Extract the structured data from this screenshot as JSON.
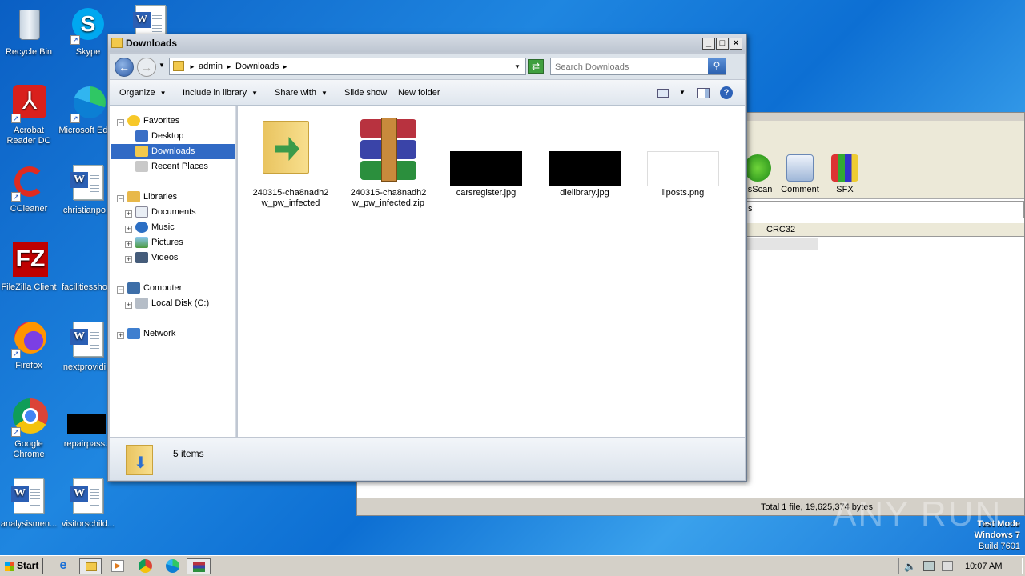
{
  "desktop": {
    "icons": [
      {
        "label": "Recycle Bin"
      },
      {
        "label": "Skype"
      },
      {
        "label": "Acrobat Reader DC"
      },
      {
        "label": "Microsoft Edge"
      },
      {
        "label": "CCleaner"
      },
      {
        "label": "christianpo..."
      },
      {
        "label": "FileZilla Client"
      },
      {
        "label": "facilitiessho..."
      },
      {
        "label": "Firefox"
      },
      {
        "label": "nextprovidi..."
      },
      {
        "label": "Google Chrome"
      },
      {
        "label": "repairpass..."
      },
      {
        "label": "analysismen..."
      },
      {
        "label": "visitorschild..."
      }
    ],
    "watermark": "ANY RUN",
    "os_info": {
      "line1": "Test Mode",
      "line2": "Windows 7",
      "line3": "Build 7601"
    }
  },
  "winrar": {
    "tools": [
      "usScan",
      "Comment",
      "SFX"
    ],
    "column_crc": "CRC32",
    "address_fragment": "s",
    "status": "Total 1 file, 19,625,374 bytes"
  },
  "explorer": {
    "title": "Downloads",
    "breadcrumb": [
      "admin",
      "Downloads"
    ],
    "search_placeholder": "Search Downloads",
    "commands": {
      "organize": "Organize",
      "include": "Include in library",
      "share": "Share with",
      "slideshow": "Slide show",
      "newfolder": "New folder"
    },
    "nav": {
      "favorites": "Favorites",
      "desktop": "Desktop",
      "downloads": "Downloads",
      "recent": "Recent Places",
      "libraries": "Libraries",
      "documents": "Documents",
      "music": "Music",
      "pictures": "Pictures",
      "videos": "Videos",
      "computer": "Computer",
      "localdisk": "Local Disk (C:)",
      "network": "Network"
    },
    "files": [
      {
        "name": "240315-cha8nadh2w_pw_infected"
      },
      {
        "name": "240315-cha8nadh2w_pw_infected.zip"
      },
      {
        "name": "carsregister.jpg"
      },
      {
        "name": "dielibrary.jpg"
      },
      {
        "name": "ilposts.png"
      }
    ],
    "details": {
      "count": "5 items"
    }
  },
  "taskbar": {
    "start": "Start",
    "clock": "10:07 AM"
  }
}
